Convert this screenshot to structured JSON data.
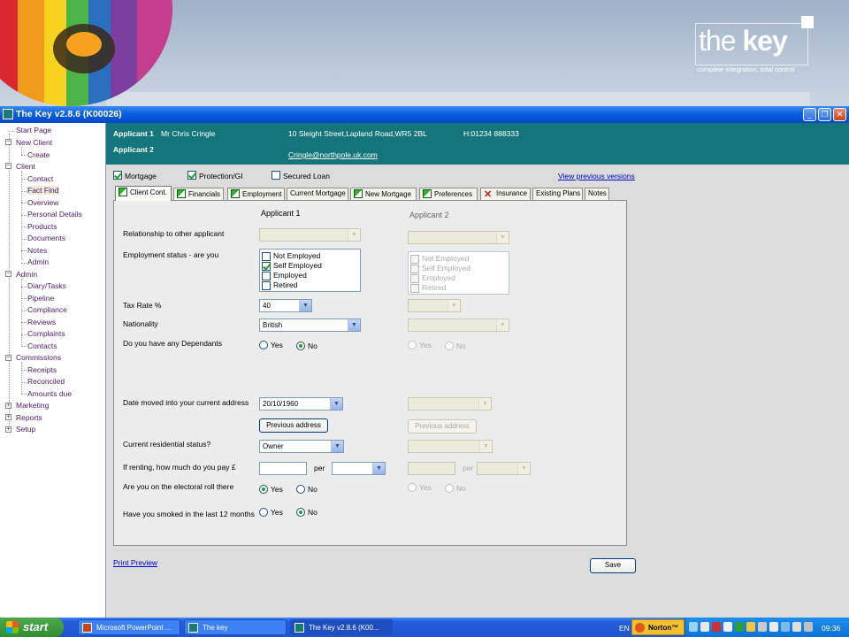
{
  "banner": {
    "logo_word_light": "the ",
    "logo_word_bold": "key",
    "logo_tagline": "complete integration. total control"
  },
  "window": {
    "title": "The Key v2.8.6 (K00026)"
  },
  "nav": {
    "start_page": "Start Page",
    "new_client": "New Client",
    "create": "Create",
    "client": "Client",
    "contact": "Contact",
    "fact_find": "Fact Find",
    "overview": "Overview",
    "personal_details": "Personal Details",
    "products": "Products",
    "documents": "Documents",
    "notes": "Notes",
    "admin_child": "Admin",
    "admin": "Admin",
    "diary_tasks": "Diary/Tasks",
    "pipeline": "Pipeline",
    "compliance": "Compliance",
    "reviews": "Reviews",
    "complaints": "Complaints",
    "contacts": "Contacts",
    "commissions": "Commissions",
    "receipts": "Receipts",
    "reconciled": "Reconciled",
    "amounts_due": "Amounts due",
    "marketing": "Marketing",
    "reports": "Reports",
    "setup": "Setup"
  },
  "header": {
    "applicant1_label": "Applicant 1",
    "applicant1_name": "Mr Chris Cringle",
    "address": "10 Sleight Street,Lapland Road,WR5 2BL",
    "phone": "H:01234 888333",
    "applicant2_label": "Applicant 2",
    "email": "Cringle@northpole.uk.com"
  },
  "products": {
    "mortgage": "Mortgage",
    "protection": "Protection/GI",
    "secured_loan": "Secured Loan",
    "view_versions": "View previous versions"
  },
  "tabs": {
    "client_cont": "Client Cont.",
    "financials": "Financials",
    "employment": "Employment",
    "current_mortgage": "Current Mortgage",
    "new_mortgage": "New Mortgage",
    "preferences": "Preferences",
    "insurance": "Insurance",
    "existing_plans": "Existing Plans",
    "notes": "Notes"
  },
  "form": {
    "col1": "Applicant 1",
    "col2": "Applicant 2",
    "relationship_label": "Relationship to other applicant",
    "employment_label": "Employment status - are you",
    "employment_options": [
      "Not Employed",
      "Self Employed",
      "Employed",
      "Retired"
    ],
    "tax_rate_label": "Tax Rate %",
    "tax_rate_value": "40",
    "nationality_label": "Nationality",
    "nationality_value": "British",
    "dependants_label": "Do you have any Dependants",
    "yes": "Yes",
    "no": "No",
    "date_moved_label": "Date moved into your current address",
    "date_moved_value": "20/10/1960",
    "previous_address": "Previous address",
    "residential_label": "Current residential status?",
    "residential_value": "Owner",
    "renting_label": "If renting, how much do you pay £",
    "per": "per",
    "electoral_label": "Are you on the electoral roll there",
    "smoked_label": "Have you smoked in the last 12 months"
  },
  "footer": {
    "print_preview": "Print Preview",
    "save": "Save"
  },
  "taskbar": {
    "start": "start",
    "task1": "Microsoft PowerPoint ...",
    "task2": "The key",
    "task3": "The Key v2.8.6 (K00...",
    "lang": "EN",
    "norton": "Norton™",
    "clock": "09:36"
  }
}
